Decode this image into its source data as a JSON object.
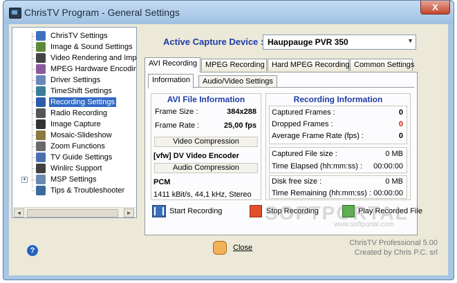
{
  "window": {
    "title": "ChrisTV Program - General Settings",
    "close_symbol": "X"
  },
  "tree": {
    "items": [
      {
        "label": "ChrisTV Settings",
        "icon": "settings-icon",
        "color": "#3f70c0"
      },
      {
        "label": "Image & Sound Settings",
        "icon": "image-sound-icon",
        "color": "#5d8a3a"
      },
      {
        "label": "Video Rendering and Improvements",
        "icon": "video-icon",
        "color": "#444444"
      },
      {
        "label": "MPEG Hardware Encoding",
        "icon": "mpeg-icon",
        "color": "#8a5b9c"
      },
      {
        "label": "Driver Settings",
        "icon": "driver-icon",
        "color": "#6a88b8"
      },
      {
        "label": "TimeShift Settings",
        "icon": "timeshift-icon",
        "color": "#3b7d98"
      },
      {
        "label": "Recording Settings",
        "icon": "recording-icon",
        "color": "#2c5ca8"
      },
      {
        "label": "Radio Recording",
        "icon": "radio-icon",
        "color": "#555555"
      },
      {
        "label": "Image Capture",
        "icon": "camera-icon",
        "color": "#333333"
      },
      {
        "label": "Mosaic-Slideshow",
        "icon": "mosaic-icon",
        "color": "#8a7a40"
      },
      {
        "label": "Zoom Functions",
        "icon": "zoom-icon",
        "color": "#6a6a6a"
      },
      {
        "label": "TV Guide Settings",
        "icon": "tvguide-icon",
        "color": "#4a70b0"
      },
      {
        "label": "Winlirc Support",
        "icon": "remote-icon",
        "color": "#404040"
      },
      {
        "label": "MSP Settings",
        "icon": "msp-icon",
        "color": "#6a8ab0",
        "expander": "+"
      },
      {
        "label": "Tips & Troubleshooter",
        "icon": "tips-icon",
        "color": "#3a6aa0"
      }
    ],
    "selected_index": 6,
    "scroll_left": "◄",
    "scroll_right": "►"
  },
  "capture": {
    "label": "Active Capture Device :",
    "value": "Hauppauge PVR 350",
    "arrow": "▼"
  },
  "tabs": [
    "AVI Recording",
    "MPEG Recording",
    "Hard MPEG Recording",
    "Common Settings"
  ],
  "subtabs": [
    "Information",
    "Audio/Video Settings"
  ],
  "avi_info": {
    "title": "AVI File Information",
    "frame_size_label": "Frame Size :",
    "frame_size_value": "384x288",
    "frame_rate_label": "Frame Rate :",
    "frame_rate_value": "25,00 fps",
    "video_compression_label": "Video Compression",
    "video_codec": "[vfw] DV Video Encoder",
    "audio_compression_label": "Audio Compression",
    "audio_codec": "PCM",
    "audio_details": "1411 kBit/s, 44,1 kHz, Stereo"
  },
  "recording_info": {
    "title": "Recording Information",
    "captured_frames_label": "Captured Frames :",
    "captured_frames_value": "0",
    "dropped_frames_label": "Dropped Frames :",
    "dropped_frames_value": "0",
    "avg_frame_rate_label": "Average Frame Rate (fps) :",
    "avg_frame_rate_value": "0",
    "captured_file_size_label": "Captured File size :",
    "captured_file_size_value": "0 MB",
    "time_elapsed_label": "Time Elapsed (hh:mm:ss) :",
    "time_elapsed_value": "00:00:00",
    "disk_free_label": "Disk free size :",
    "disk_free_value": "0 MB",
    "time_remaining_label": "Time Remaining (hh:mm:ss) :",
    "time_remaining_value": "00:00:00"
  },
  "buttons": {
    "start": "Start Recording",
    "stop": "Stop Recording",
    "play": "Play Recorded File",
    "close": "Close",
    "help": "?"
  },
  "footer": {
    "version": "ChrisTV Professional 5.00",
    "credit": "Created by Chris P.C. srl"
  },
  "watermark": {
    "text": "SOFTPORTAL",
    "url": "www.softportal.com"
  }
}
